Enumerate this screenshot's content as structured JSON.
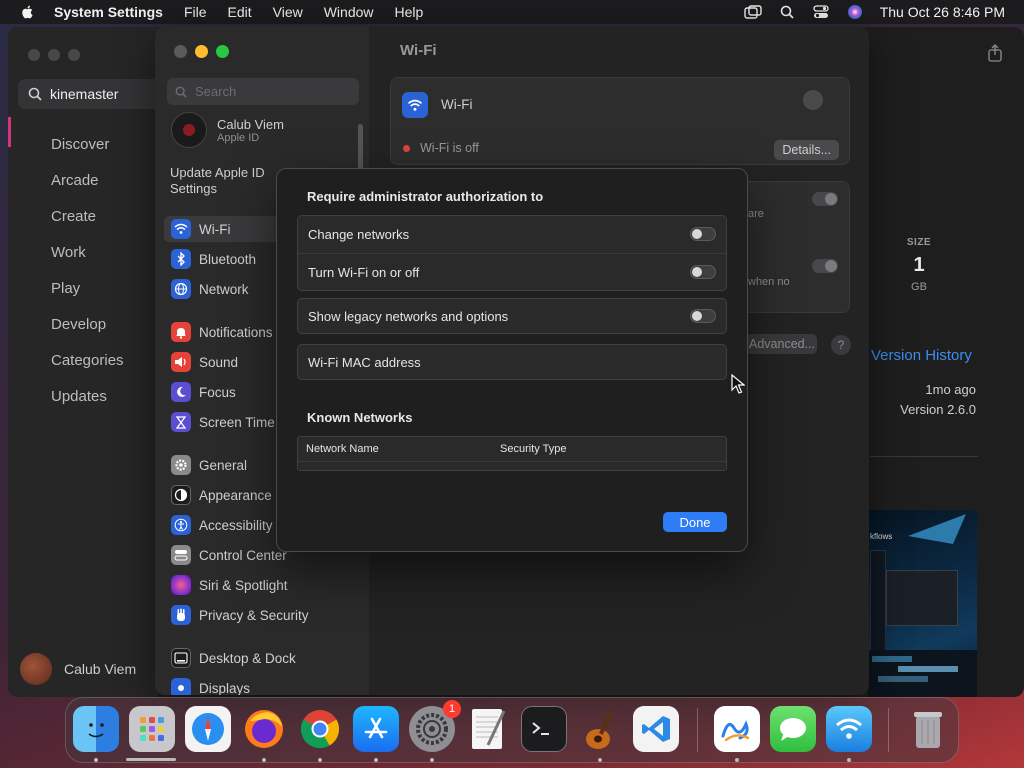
{
  "menubar": {
    "app_name": "System Settings",
    "items": [
      "File",
      "Edit",
      "View",
      "Window",
      "Help"
    ],
    "clock": "Thu Oct 26  8:46 PM"
  },
  "appstore": {
    "search_value": "kinemaster",
    "nav": [
      "Discover",
      "Arcade",
      "Create",
      "Work",
      "Play",
      "Develop",
      "Categories",
      "Updates"
    ],
    "user_name": "Calub Viem",
    "size_label": "SIZE",
    "size_value": "1",
    "size_unit": "GB",
    "version_history": "Version History",
    "updated_ago": "1mo ago",
    "version": "Version 2.6.0",
    "screenshot_label": "kflows"
  },
  "settings": {
    "search_placeholder": "Search",
    "user_name": "Calub Viem",
    "user_sub": "Apple ID",
    "update_text": "Update Apple ID Settings",
    "sidebar": [
      {
        "label": "Wi-Fi",
        "icon": "wifi-icon",
        "color": "#2b63d6",
        "selected": true
      },
      {
        "label": "Bluetooth",
        "icon": "bluetooth-icon",
        "color": "#2b63d6"
      },
      {
        "label": "Network",
        "icon": "globe-icon",
        "color": "#2b63d6"
      },
      {
        "label": "Notifications",
        "icon": "bell-icon",
        "color": "#e5433a"
      },
      {
        "label": "Sound",
        "icon": "speaker-icon",
        "color": "#e5433a"
      },
      {
        "label": "Focus",
        "icon": "moon-icon",
        "color": "#5b4ed1"
      },
      {
        "label": "Screen Time",
        "icon": "hourglass-icon",
        "color": "#5b4ed1"
      },
      {
        "label": "General",
        "icon": "gear-icon",
        "color": "#8a8a8c"
      },
      {
        "label": "Appearance",
        "icon": "appearance-icon",
        "color": "#1c1c1e"
      },
      {
        "label": "Accessibility",
        "icon": "accessibility-icon",
        "color": "#2b63d6"
      },
      {
        "label": "Control Center",
        "icon": "control-center-icon",
        "color": "#8a8a8c"
      },
      {
        "label": "Siri & Spotlight",
        "icon": "siri-icon",
        "color": "#c0398f"
      },
      {
        "label": "Privacy & Security",
        "icon": "hand-icon",
        "color": "#2b63d6"
      },
      {
        "label": "Desktop & Dock",
        "icon": "dock-icon",
        "color": "#1c1c1e"
      },
      {
        "label": "Displays",
        "icon": "displays-icon",
        "color": "#2b63d6"
      }
    ],
    "main_title": "Wi-Fi",
    "wifi_label": "Wi-Fi",
    "wifi_status": "Wi-Fi is off",
    "details_button": "Details...",
    "frag_are": "are",
    "frag_when_no": "when no",
    "advanced_button": "Advanced...",
    "help_button": "?"
  },
  "sheet": {
    "heading": "Require administrator authorization to",
    "auth_rows": [
      {
        "label": "Change networks",
        "on": false
      },
      {
        "label": "Turn Wi-Fi on or off",
        "on": false
      }
    ],
    "legacy_label": "Show legacy networks and options",
    "legacy_on": false,
    "mac_label": "Wi-Fi MAC address",
    "known_heading": "Known Networks",
    "col_network": "Network Name",
    "col_security": "Security Type",
    "done_button": "Done"
  },
  "dock": {
    "apps": [
      "Finder",
      "Launchpad",
      "Safari",
      "Firefox",
      "Chrome",
      "App Store",
      "System Settings",
      "TextEdit",
      "Terminal",
      "GarageBand",
      "Visual Studio Code",
      "Freeform",
      "Messages",
      "Wireless Diagnostics",
      "Trash"
    ],
    "settings_badge": "1"
  }
}
